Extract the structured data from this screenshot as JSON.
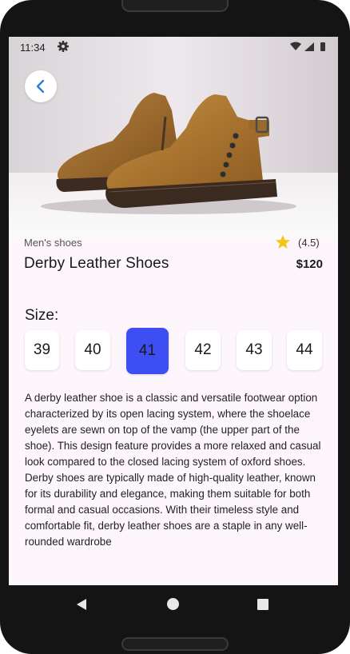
{
  "status_bar": {
    "time": "11:34"
  },
  "product": {
    "category": "Men's shoes",
    "rating": "(4.5)",
    "title": "Derby Leather Shoes",
    "price": "$120",
    "size_label": "Size:",
    "sizes": [
      "39",
      "40",
      "41",
      "42",
      "43",
      "44"
    ],
    "selected_size": "41",
    "description": "A derby leather shoe is a classic and versatile footwear option characterized by its open lacing system, where the shoelace eyelets are sewn on top of the vamp (the upper part of the shoe). This design feature provides a more relaxed and casual look compared to the closed lacing system of oxford shoes. Derby shoes are typically made of high-quality leather, known for its durability and elegance, making them suitable for both formal and casual occasions. With their timeless style and comfortable fit, derby leather shoes are a staple in any well-rounded wardrobe"
  },
  "icons": {
    "back": "chevron-left-icon",
    "star": "star-icon",
    "gear": "gear-icon",
    "wifi": "wifi-icon",
    "signal": "signal-icon",
    "battery": "battery-icon"
  },
  "colors": {
    "accent": "#3d4ff2",
    "star": "#f5c518",
    "back_chevron": "#2e7dd7",
    "screen_background": "#fdf7fd"
  }
}
